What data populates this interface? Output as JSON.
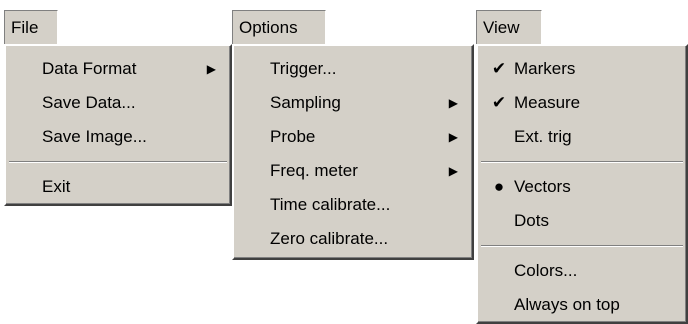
{
  "menus": {
    "file": {
      "title": "File",
      "items": [
        {
          "label": "Data Format",
          "submenu": true
        },
        {
          "label": "Save Data..."
        },
        {
          "label": "Save Image..."
        },
        {
          "label": "Exit"
        }
      ]
    },
    "options": {
      "title": "Options",
      "items": [
        {
          "label": "Trigger..."
        },
        {
          "label": "Sampling",
          "submenu": true
        },
        {
          "label": "Probe",
          "submenu": true
        },
        {
          "label": "Freq. meter",
          "submenu": true
        },
        {
          "label": "Time calibrate..."
        },
        {
          "label": "Zero calibrate..."
        }
      ]
    },
    "view": {
      "title": "View",
      "items": [
        {
          "label": "Markers",
          "checked": true
        },
        {
          "label": "Measure",
          "checked": true
        },
        {
          "label": "Ext. trig"
        },
        {
          "label": "Vectors",
          "radio": true
        },
        {
          "label": "Dots"
        },
        {
          "label": "Colors..."
        },
        {
          "label": "Always on top"
        }
      ]
    }
  },
  "icons": {
    "submenu": "chevron-right-icon",
    "check": "checkmark-icon",
    "radio": "radio-dot-icon"
  },
  "colors": {
    "menu_face": "#d4d0c8",
    "shadow": "#808080",
    "highlight": "#ffffff"
  }
}
